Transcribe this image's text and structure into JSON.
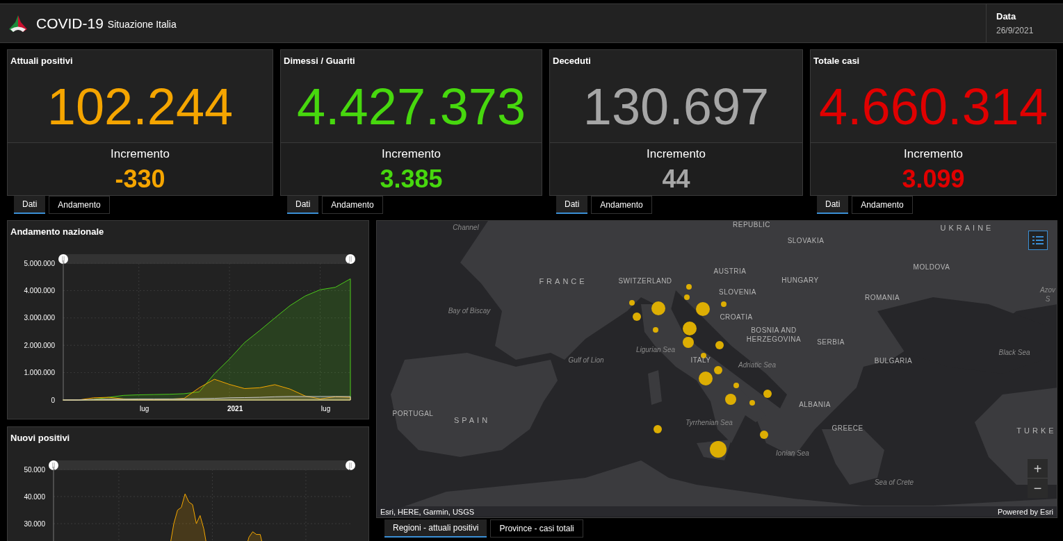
{
  "header": {
    "title": "COVID-19",
    "subtitle": "Situazione Italia",
    "date_label": "Data",
    "date": "26/9/2021"
  },
  "cards": [
    {
      "title": "Attuali positivi",
      "value": "102.244",
      "increment_label": "Incremento",
      "increment": "-330",
      "color": "#f5a500",
      "tabs": [
        {
          "label": "Dati",
          "selected": true
        },
        {
          "label": "Andamento",
          "selected": false
        }
      ]
    },
    {
      "title": "Dimessi / Guariti",
      "value": "4.427.373",
      "increment_label": "Incremento",
      "increment": "3.385",
      "color": "#47d80e",
      "tabs": [
        {
          "label": "Dati",
          "selected": true
        },
        {
          "label": "Andamento",
          "selected": false
        }
      ]
    },
    {
      "title": "Deceduti",
      "value": "130.697",
      "increment_label": "Incremento",
      "increment": "44",
      "color": "#a6a6a6",
      "tabs": [
        {
          "label": "Dati",
          "selected": true
        },
        {
          "label": "Andamento",
          "selected": false
        }
      ]
    },
    {
      "title": "Totale casi",
      "value": "4.660.314",
      "increment_label": "Incremento",
      "increment": "3.099",
      "color": "#e00000",
      "tabs": [
        {
          "label": "Dati",
          "selected": true
        },
        {
          "label": "Andamento",
          "selected": false
        }
      ]
    }
  ],
  "charts": [
    {
      "title": "Andamento nazionale",
      "chart_data": {
        "type": "area",
        "grid": true,
        "categories": [
          null,
          null,
          null,
          null,
          null,
          "lug",
          null,
          null,
          null,
          null,
          null,
          "2021",
          null,
          null,
          null,
          null,
          null,
          "lug",
          null,
          null
        ],
        "ylim": [
          0,
          5000000
        ],
        "yticks": [
          {
            "value": 0,
            "label": "0"
          },
          {
            "value": 1000000,
            "label": "1.000.000"
          },
          {
            "value": 2000000,
            "label": "2.000.000"
          },
          {
            "value": 3000000,
            "label": "3.000.000"
          },
          {
            "value": 4000000,
            "label": "4.000.000"
          },
          {
            "value": 5000000,
            "label": "5.000.000"
          }
        ],
        "series": [
          {
            "color": "#4ccc1a",
            "values": [
              0,
              0,
              20000,
              100000,
              170000,
              190000,
              200000,
              210000,
              230000,
              300000,
              960000,
              1500000,
              2100000,
              2540000,
              3000000,
              3450000,
              3800000,
              4030000,
              4120000,
              4430000
            ]
          },
          {
            "color": "#f5a800",
            "values": [
              0,
              0,
              80000,
              100000,
              40000,
              20000,
              10000,
              30000,
              60000,
              450000,
              760000,
              570000,
              420000,
              450000,
              560000,
              400000,
              150000,
              40000,
              120000,
              100000
            ]
          },
          {
            "color": "#c8c8c8",
            "values": [
              0,
              0,
              20000,
              30000,
              30000,
              40000,
              40000,
              40000,
              40000,
              50000,
              60000,
              80000,
              90000,
              100000,
              120000,
              130000,
              130000,
              130000,
              130000,
              130000
            ]
          }
        ]
      }
    },
    {
      "title": "Nuovi positivi",
      "chart_data": {
        "type": "area",
        "grid": true,
        "categories": [
          null,
          null,
          null,
          null,
          null,
          null,
          null,
          null,
          null,
          null,
          null,
          null,
          null,
          null,
          null,
          null,
          null,
          null,
          null,
          null,
          null,
          null,
          null,
          null,
          null,
          null,
          null,
          null,
          null,
          null,
          null,
          null,
          null,
          null,
          null,
          null,
          null,
          null,
          null,
          null,
          null,
          null,
          null,
          null,
          null,
          null,
          null,
          null,
          null,
          null,
          null,
          null,
          null,
          null,
          null,
          null,
          null,
          null,
          null,
          null,
          null,
          null,
          null,
          null,
          null,
          null,
          null,
          null,
          null,
          null,
          null,
          null,
          null,
          null,
          null,
          null,
          null,
          null,
          null,
          null
        ],
        "ylim": [
          0,
          50000
        ],
        "yticks": [
          {
            "value": 30000,
            "label": "30.000"
          },
          {
            "value": 40000,
            "label": "40.000"
          },
          {
            "value": 50000,
            "label": "50.000"
          }
        ],
        "series": [
          {
            "color": "#f5a800",
            "values": [
              0,
              1000,
              3000,
              5000,
              5000,
              4000,
              3000,
              2000,
              1000,
              1000,
              0,
              0,
              0,
              0,
              0,
              0,
              0,
              1000,
              1000,
              1000,
              1000,
              2000,
              2000,
              2000,
              2000,
              3000,
              4000,
              5000,
              8000,
              12000,
              17000,
              22000,
              30000,
              35000,
              36000,
              41000,
              38000,
              37000,
              30000,
              33000,
              28000,
              20000,
              18000,
              16000,
              17000,
              14000,
              13000,
              12000,
              13000,
              14000,
              17000,
              20000,
              25000,
              27000,
              26000,
              26000,
              20000,
              16000,
              12000,
              9000,
              6000,
              4000,
              3000,
              2000,
              1000,
              1000,
              1000,
              2000,
              4000,
              6000,
              7000,
              6000,
              6000,
              5000,
              5000,
              5000,
              4000,
              4000,
              4000,
              3000
            ]
          }
        ]
      }
    }
  ],
  "map": {
    "labels": [
      {
        "text": "Channel",
        "kind": "sea"
      },
      {
        "text": "REPUBLIC",
        "kind": "country"
      },
      {
        "text": "SLOVAKIA",
        "kind": "country"
      },
      {
        "text": "UKRAINE",
        "kind": "large_country"
      },
      {
        "text": "FRANCE",
        "kind": "large_country"
      },
      {
        "text": "SWITZERLAND",
        "kind": "country"
      },
      {
        "text": "AUSTRIA",
        "kind": "country"
      },
      {
        "text": "HUNGARY",
        "kind": "country"
      },
      {
        "text": "MOLDOVA",
        "kind": "country"
      },
      {
        "text": "SLOVENIA",
        "kind": "country"
      },
      {
        "text": "ROMANIA",
        "kind": "country"
      },
      {
        "text": "Azov S",
        "kind": "sea"
      },
      {
        "text": "Bay of Biscay",
        "kind": "sea"
      },
      {
        "text": "CROATIA",
        "kind": "country"
      },
      {
        "text": "BOSNIA AND HERZEGOVINA",
        "kind": "country"
      },
      {
        "text": "SERBIA",
        "kind": "country"
      },
      {
        "text": "Black Sea",
        "kind": "sea"
      },
      {
        "text": "Ligurian Sea",
        "kind": "sea"
      },
      {
        "text": "Gulf of Lion",
        "kind": "sea"
      },
      {
        "text": "ITALY",
        "kind": "country"
      },
      {
        "text": "Adriatic Sea",
        "kind": "sea"
      },
      {
        "text": "BULGARIA",
        "kind": "country"
      },
      {
        "text": "PORTUGAL",
        "kind": "country"
      },
      {
        "text": "SPAIN",
        "kind": "large_country"
      },
      {
        "text": "ALBANIA",
        "kind": "country"
      },
      {
        "text": "Tyrrhenian Sea",
        "kind": "sea"
      },
      {
        "text": "GREECE",
        "kind": "country"
      },
      {
        "text": "TURKE",
        "kind": "large_country"
      },
      {
        "text": "Ionian Sea",
        "kind": "sea"
      },
      {
        "text": "Sea of Crete",
        "kind": "sea"
      }
    ],
    "attribution": "Esri, HERE, Garmin, USGS",
    "powered_by": "Powered by Esri",
    "zoom_in": "+",
    "zoom_out": "−",
    "tabs": [
      {
        "label": "Regioni - attuali positivi",
        "selected": true
      },
      {
        "label": "Province - casi totali",
        "selected": false
      }
    ]
  }
}
